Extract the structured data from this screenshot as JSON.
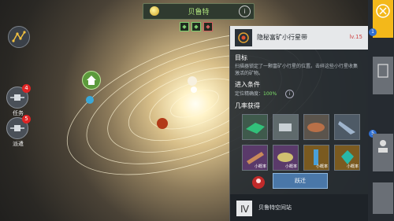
{
  "header": {
    "title": "贝鲁特",
    "info_symbol": "i",
    "stats": [
      "◆",
      "◆",
      "◆"
    ]
  },
  "left_menu": {
    "top_button": "network-icon",
    "items": [
      {
        "label": "任务",
        "badge": "4"
      },
      {
        "label": "派遣",
        "badge": "5"
      }
    ]
  },
  "panel": {
    "title": "隐秘富矿小行星带",
    "level": "lv.15",
    "goal_heading": "目标",
    "goal_text": "扫描器锁定了一颗富矿小行星的位置。击碎这些小行星收集激活的矿物。",
    "entry_heading": "进入条件",
    "entry_label": "定位精确度：",
    "entry_value": "100%",
    "reward_heading": "几率获得",
    "rewards": [
      {
        "name": "green-crystal",
        "tag": ""
      },
      {
        "name": "metal-scrap",
        "tag": ""
      },
      {
        "name": "copper-ore",
        "tag": ""
      },
      {
        "name": "blue-shard",
        "tag": ""
      },
      {
        "name": "wood-board",
        "tag": "小概率"
      },
      {
        "name": "purple-ore",
        "tag": "小概率"
      },
      {
        "name": "blue-cylinder",
        "tag": "小概率"
      },
      {
        "name": "teal-gem",
        "tag": "小概率"
      }
    ],
    "jump_button": "跃迁",
    "footer_station": "贝鲁特空间站"
  },
  "right_tabs": {
    "badges": [
      "1",
      "5"
    ]
  },
  "colors": {
    "accent": "#f3b81a",
    "badge_red": "#e02424",
    "badge_blue": "#2f6ed0",
    "title_green": "#aee27c"
  }
}
